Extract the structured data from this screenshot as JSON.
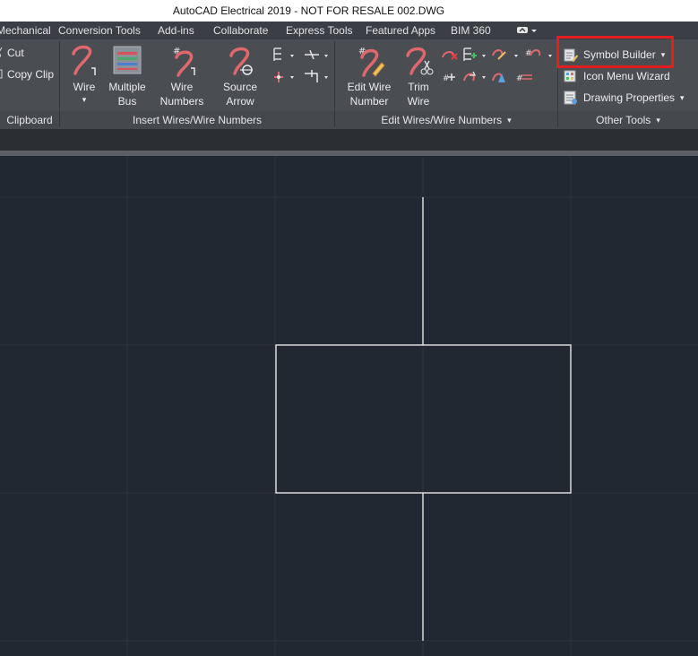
{
  "window": {
    "title": "AutoCAD Electrical 2019 - NOT FOR RESALE    002.DWG"
  },
  "tabs": [
    {
      "label": "Mechanical"
    },
    {
      "label": "Conversion Tools"
    },
    {
      "label": "Add-ins"
    },
    {
      "label": "Collaborate"
    },
    {
      "label": "Express Tools"
    },
    {
      "label": "Featured Apps"
    },
    {
      "label": "BIM 360"
    }
  ],
  "clipboard": {
    "cut": "Cut",
    "copy_clip": "Copy Clip",
    "title": "Clipboard"
  },
  "insert_wires": {
    "title": "Insert Wires/Wire Numbers",
    "wire": [
      "Wire",
      ""
    ],
    "multiple_bus": [
      "Multiple",
      "Bus"
    ],
    "wire_numbers": [
      "Wire",
      "Numbers"
    ],
    "source_arrow": [
      "Source",
      "Arrow"
    ]
  },
  "edit_wires": {
    "title": "Edit Wires/Wire Numbers",
    "edit_wire_number": [
      "Edit Wire",
      "Number"
    ],
    "trim_wire": [
      "Trim",
      "Wire"
    ]
  },
  "other_tools": {
    "title": "Other Tools",
    "symbol_builder": "Symbol Builder",
    "icon_menu_wizard": "Icon Menu  Wizard",
    "drawing_properties": "Drawing  Properties"
  },
  "colors": {
    "accent_wire": "#e0686b",
    "highlight": "#e41e1e",
    "canvas_bg": "#222831"
  }
}
